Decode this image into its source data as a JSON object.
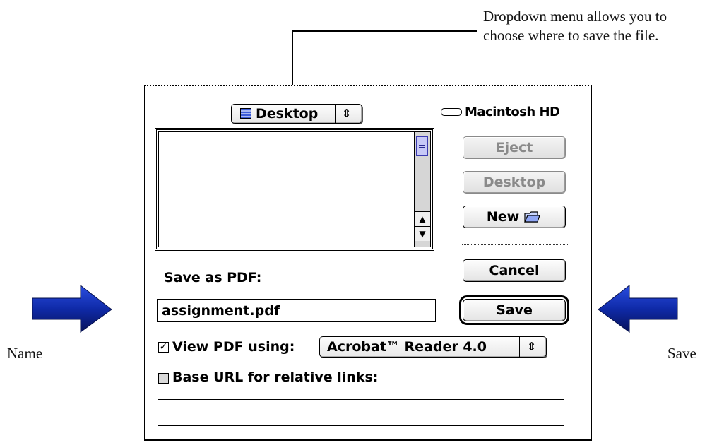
{
  "annotations": {
    "dropdown_note": "Dropdown menu allows you to choose where to save the file.",
    "name_label": "Name",
    "save_label": "Save"
  },
  "dialog": {
    "location_popup": "Desktop",
    "volume_name": "Macintosh HD",
    "buttons": {
      "eject": "Eject",
      "desktop": "Desktop",
      "new": "New",
      "cancel": "Cancel",
      "save": "Save"
    },
    "save_as_label": "Save as PDF:",
    "filename_value": "assignment.pdf",
    "view_pdf": {
      "label": "View PDF using:",
      "checked": true,
      "app": "Acrobat™ Reader 4.0"
    },
    "base_url": {
      "label": "Base URL for relative links:",
      "checked": false,
      "value": ""
    }
  },
  "icons": {
    "folder_popup": "desktop-icon",
    "new_folder": "new-folder-icon",
    "drive": "hard-drive-icon",
    "arrows": [
      "right-arrow-icon",
      "left-arrow-icon"
    ]
  },
  "colors": {
    "arrow_blue": "#1a35c8",
    "scroll_thumb": "#c7c9f7"
  }
}
